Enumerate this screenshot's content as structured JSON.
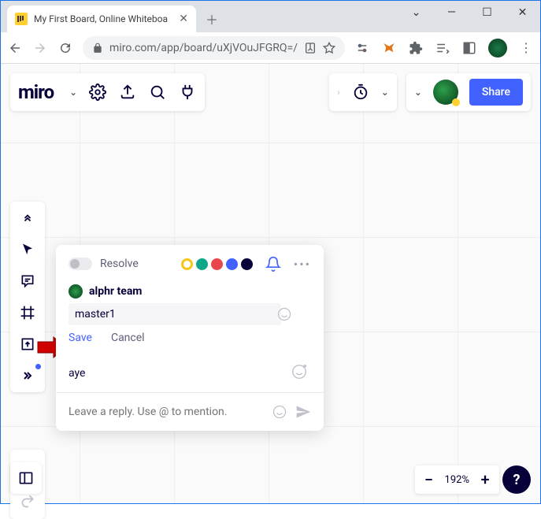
{
  "browser": {
    "tab_title": "My First Board, Online Whiteboa",
    "url": "miro.com/app/board/uXjVOuJFGRQ=/"
  },
  "header": {
    "logo": "miro",
    "share_label": "Share"
  },
  "comment": {
    "resolve_label": "Resolve",
    "author": "alphr team",
    "edit_value": "master1",
    "save_label": "Save",
    "cancel_label": "Cancel",
    "reply_text": "aye",
    "reply_placeholder": "Leave a reply. Use @ to mention."
  },
  "zoom": {
    "level": "192%"
  }
}
